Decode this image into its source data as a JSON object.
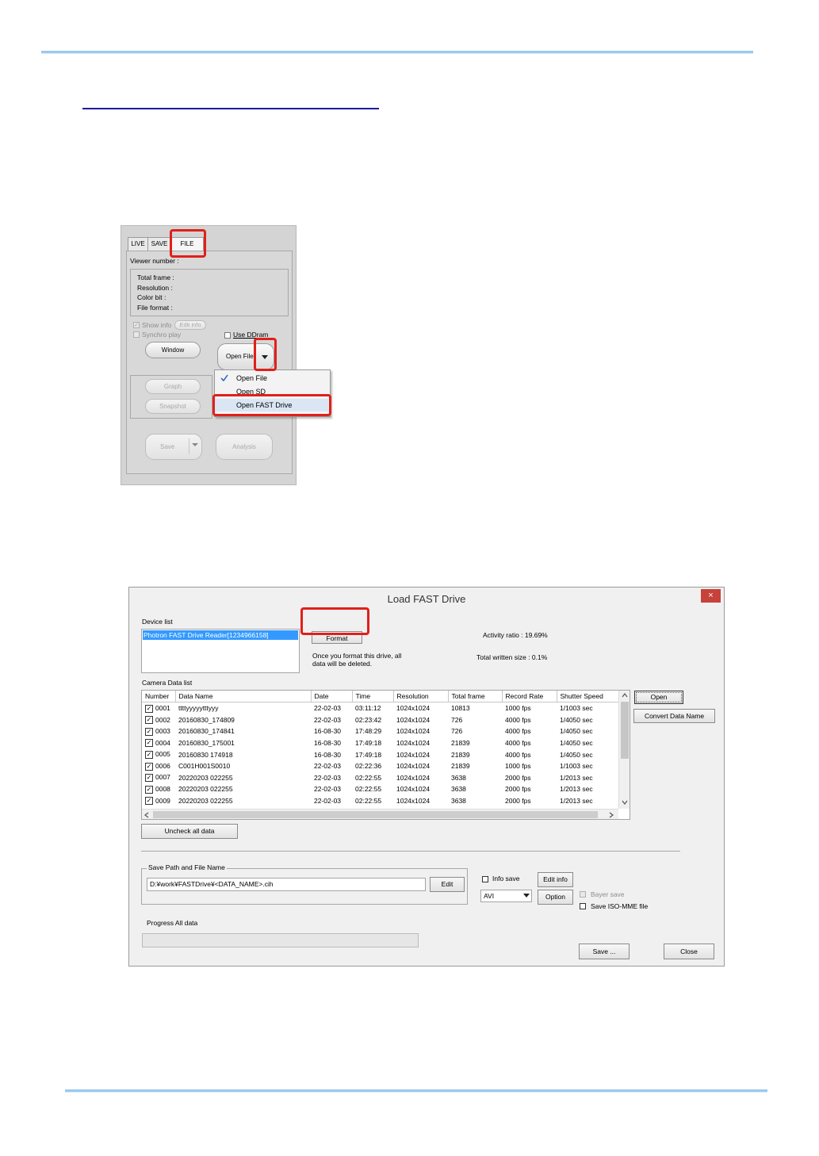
{
  "viewer": {
    "tabs": [
      "LIVE",
      "SAVE",
      "FILE"
    ],
    "viewer_number": "Viewer number :",
    "info": [
      "Total frame :",
      "Resolution :",
      "Color bit :",
      "File format :"
    ],
    "show_info": "Show info",
    "edit_info": "Edit info",
    "synchro_play": "Synchro play",
    "use_dram": "Use DDram",
    "window": "Window",
    "open_file": "Open File",
    "graph": "Graph",
    "snapshot": "Snapshot",
    "save": "Save",
    "analysis": "Analysis",
    "menu": [
      "Open File",
      "Open SD",
      "Open FAST Drive"
    ]
  },
  "dialog": {
    "title": "Load FAST Drive",
    "close_x": "×",
    "device_list_label": "Device list",
    "device_selected": "Photron FAST Drive Reader[1234966158]",
    "format_button": "Format",
    "format_note_line1": "Once you format this drive, all",
    "format_note_line2": "data will be deleted.",
    "activity_ratio": "Activity ratio : 19.69%",
    "total_written": "Total written size : 0.1%",
    "camera_data_label": "Camera Data list",
    "columns": [
      "Number",
      "Data Name",
      "Date",
      "Time",
      "Resolution",
      "Total frame",
      "Record Rate",
      "Shutter Speed"
    ],
    "rows": [
      [
        "0001",
        "ttttyyyyytttyyy",
        "22-02-03",
        "03:11:12",
        "1024x1024",
        "10813",
        "1000 fps",
        "1/1003 sec"
      ],
      [
        "0002",
        "20160830_174809",
        "22-02-03",
        "02:23:42",
        "1024x1024",
        "726",
        "4000 fps",
        "1/4050 sec"
      ],
      [
        "0003",
        "20160830_174841",
        "16-08-30",
        "17:48:29",
        "1024x1024",
        "726",
        "4000 fps",
        "1/4050 sec"
      ],
      [
        "0004",
        "20160830_175001",
        "16-08-30",
        "17:49:18",
        "1024x1024",
        "21839",
        "4000 fps",
        "1/4050 sec"
      ],
      [
        "0005",
        "20160830 174918",
        "16-08-30",
        "17:49:18",
        "1024x1024",
        "21839",
        "4000 fps",
        "1/4050 sec"
      ],
      [
        "0006",
        "C001H001S0010",
        "22-02-03",
        "02:22:36",
        "1024x1024",
        "21839",
        "1000 fps",
        "1/1003 sec"
      ],
      [
        "0007",
        "20220203 022255",
        "22-02-03",
        "02:22:55",
        "1024x1024",
        "3638",
        "2000 fps",
        "1/2013 sec"
      ],
      [
        "0008",
        "20220203 022255",
        "22-02-03",
        "02:22:55",
        "1024x1024",
        "3638",
        "2000 fps",
        "1/2013 sec"
      ],
      [
        "0009",
        "20220203 022255",
        "22-02-03",
        "02:22:55",
        "1024x1024",
        "3638",
        "2000 fps",
        "1/2013 sec"
      ]
    ],
    "open_button": "Open",
    "convert_button": "Convert Data Name",
    "uncheck_button": "Uncheck all data",
    "save_path_group": "Save Path and File Name",
    "save_path_value": "D:¥work¥FASTDrive¥<DATA_NAME>.cih",
    "edit_button": "Edit",
    "info_save": "Info save",
    "edit_info_button": "Edit info",
    "format_select": "AVI",
    "option_button": "Option",
    "bayer_save": "Bayer save",
    "save_iso": "Save ISO-MME file",
    "progress_label": "Progress All data",
    "save_button": "Save ...",
    "close_button": "Close"
  }
}
